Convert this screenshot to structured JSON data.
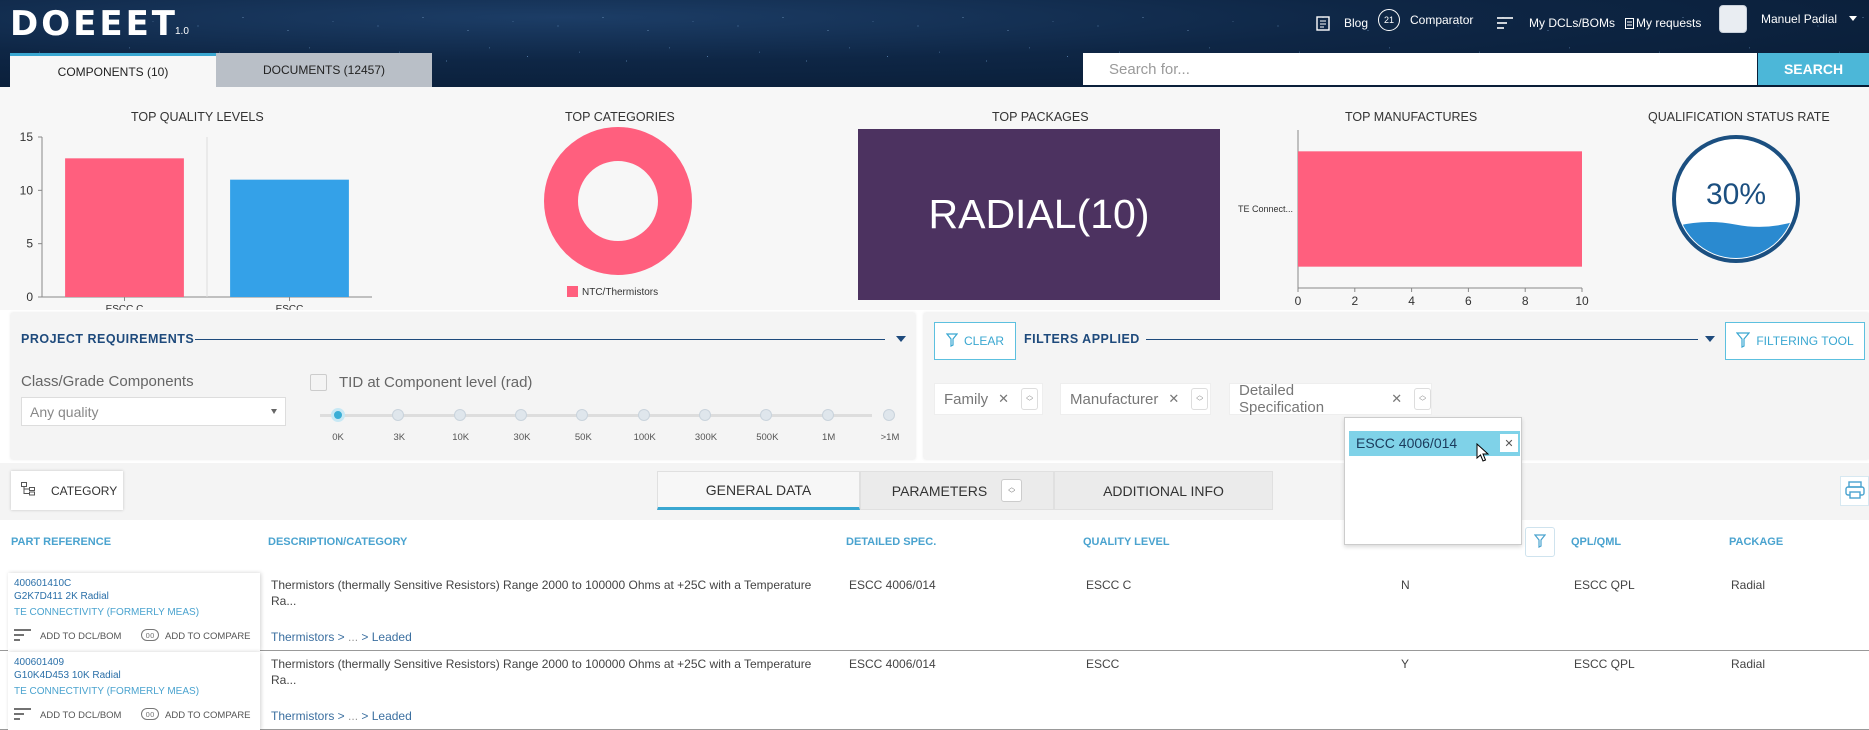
{
  "header": {
    "logo": "DOEEET",
    "logo_version": "1.0",
    "nav": {
      "blog": "Blog",
      "comparator": "Comparator",
      "comparator_badge": "21",
      "dcls": "My DCLs/BOMs",
      "requests": "My requests",
      "user": "Manuel Padial"
    },
    "tabs": {
      "components": "COMPONENTS (10)",
      "documents": "DOCUMENTS (12457)"
    },
    "search": {
      "placeholder": "Search for...",
      "button": "SEARCH"
    }
  },
  "dashboard": {
    "quality_title": "TOP QUALITY LEVELS",
    "categories_title": "TOP CATEGORIES",
    "packages_title": "TOP PACKAGES",
    "manufactures_title": "TOP MANUFACTURES",
    "status_title": "QUALIFICATION STATUS RATE",
    "package_label": "RADIAL(10)",
    "status_rate": "30%",
    "status_fill": 0.3,
    "colors": {
      "pink": "#ff5f7e",
      "blue": "#34a1e8",
      "purple": "#4c3260",
      "navy": "#1b4f80"
    }
  },
  "chart_data": [
    {
      "type": "bar",
      "title": "TOP QUALITY LEVELS",
      "categories": [
        "ESCC C",
        "ESCC"
      ],
      "values": [
        13,
        11
      ],
      "colors": [
        "#ff5f7e",
        "#34a1e8"
      ],
      "ylim": [
        0,
        15
      ],
      "yticks": [
        "0",
        "5",
        "10",
        "15"
      ]
    },
    {
      "type": "pie",
      "title": "TOP CATEGORIES",
      "labels": [
        "NTC/Thermistors"
      ],
      "values": [
        10
      ],
      "colors": [
        "#ff5f7e"
      ],
      "legend": "bottom"
    },
    {
      "type": "bar",
      "orientation": "horizontal",
      "title": "TOP MANUFACTURES",
      "categories": [
        "TE Connect..."
      ],
      "values": [
        10
      ],
      "colors": [
        "#ff5f7e"
      ],
      "xlim": [
        0,
        10
      ],
      "xticks": [
        "0",
        "2",
        "4",
        "6",
        "8",
        "10"
      ]
    }
  ],
  "project": {
    "title": "PROJECT REQUIREMENTS",
    "class_label": "Class/Grade Components",
    "class_value": "Any quality",
    "tid_label": "TID at Component level (rad)",
    "tid_steps": [
      "0K",
      "3K",
      "10K",
      "30K",
      "50K",
      "100K",
      "300K",
      "500K",
      "1M",
      ">1M"
    ]
  },
  "filters": {
    "clear": "CLEAR",
    "title": "FILTERS APPLIED",
    "tool": "FILTERING TOOL",
    "chips": [
      "Family",
      "Manufacturer",
      "Detailed Specification"
    ],
    "dropdown_item": "ESCC 4006/014"
  },
  "toolbar": {
    "category": "CATEGORY",
    "tabs": [
      "GENERAL DATA",
      "PARAMETERS",
      "ADDITIONAL INFO"
    ]
  },
  "table": {
    "columns": [
      "PART REFERENCE",
      "DESCRIPTION/CATEGORY",
      "DETAILED SPEC.",
      "QUALITY LEVEL",
      "QPL/QML",
      "PACKAGE"
    ],
    "actions": {
      "add_dcl": "ADD TO DCL/BOM",
      "add_compare": "ADD TO COMPARE"
    },
    "rows": [
      {
        "part": "400601410C",
        "model": "G2K7D411 2K Radial",
        "manufacturer": "TE CONNECTIVITY (FORMERLY MEAS)",
        "desc1": "Thermistors (thermally Sensitive Resistors) Range 2000 to 100000 Ohms at +25C with a Temperature",
        "desc2": "Ra...",
        "crumb_start": "Thermistors >",
        "crumb_mid": "...",
        "crumb_end": "> Leaded",
        "spec": "ESCC 4006/014",
        "quality": "ESCC C",
        "flag": "N",
        "qpl": "ESCC QPL",
        "package": "Radial"
      },
      {
        "part": "400601409",
        "model": "G10K4D453 10K Radial",
        "manufacturer": "TE CONNECTIVITY (FORMERLY MEAS)",
        "desc1": "Thermistors (thermally Sensitive Resistors) Range 2000 to 100000 Ohms at +25C with a Temperature",
        "desc2": "Ra...",
        "crumb_start": "Thermistors >",
        "crumb_mid": "...",
        "crumb_end": "> Leaded",
        "spec": "ESCC 4006/014",
        "quality": "ESCC",
        "flag": "Y",
        "qpl": "ESCC QPL",
        "package": "Radial"
      }
    ]
  }
}
